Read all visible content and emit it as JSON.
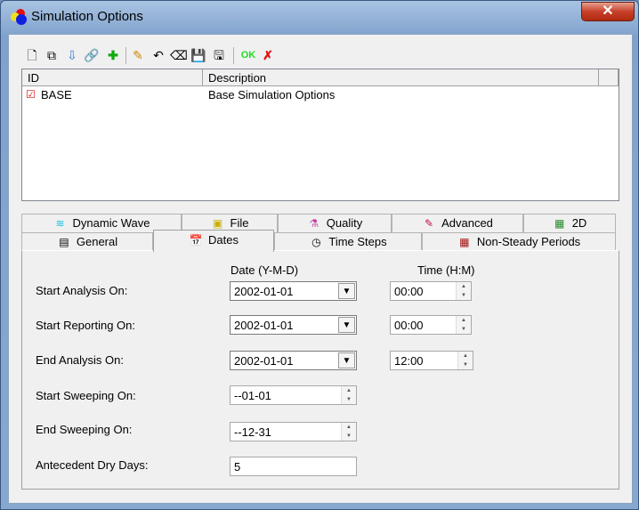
{
  "window": {
    "title": "Simulation Options",
    "close_label": "✕"
  },
  "toolbar": {
    "icons": [
      "new-icon",
      "copy-icon",
      "import-icon",
      "link-icon",
      "add-id-icon",
      "edit-icon",
      "restore-icon",
      "erase-icon",
      "save-icon",
      "save-as-icon"
    ],
    "ok_label": "OK",
    "cancel_label": "✗"
  },
  "list": {
    "columns": [
      "ID",
      "Description"
    ],
    "rows": [
      {
        "id": "BASE",
        "description": "Base Simulation Options"
      }
    ]
  },
  "tabs": {
    "row1": [
      "Dynamic Wave",
      "File",
      "Quality",
      "Advanced",
      "2D"
    ],
    "row2": [
      "General",
      "Dates",
      "Time Steps",
      "Non-Steady Periods"
    ],
    "selected": "Dates"
  },
  "dates": {
    "date_header": "Date (Y-M-D)",
    "time_header": "Time (H:M)",
    "start_analysis": {
      "label": "Start Analysis On:",
      "date": "2002-01-01",
      "time": "00:00"
    },
    "start_reporting": {
      "label": "Start Reporting On:",
      "date": "2002-01-01",
      "time": "00:00"
    },
    "end_analysis": {
      "label": "End Analysis On:",
      "date": "2002-01-01",
      "time": "12:00"
    },
    "start_sweeping": {
      "label": "Start Sweeping On:",
      "value": "--01-01"
    },
    "end_sweeping": {
      "label": "End Sweeping On:",
      "value": "--12-31"
    },
    "antecedent": {
      "label": "Antecedent Dry Days:",
      "value": "5"
    }
  }
}
